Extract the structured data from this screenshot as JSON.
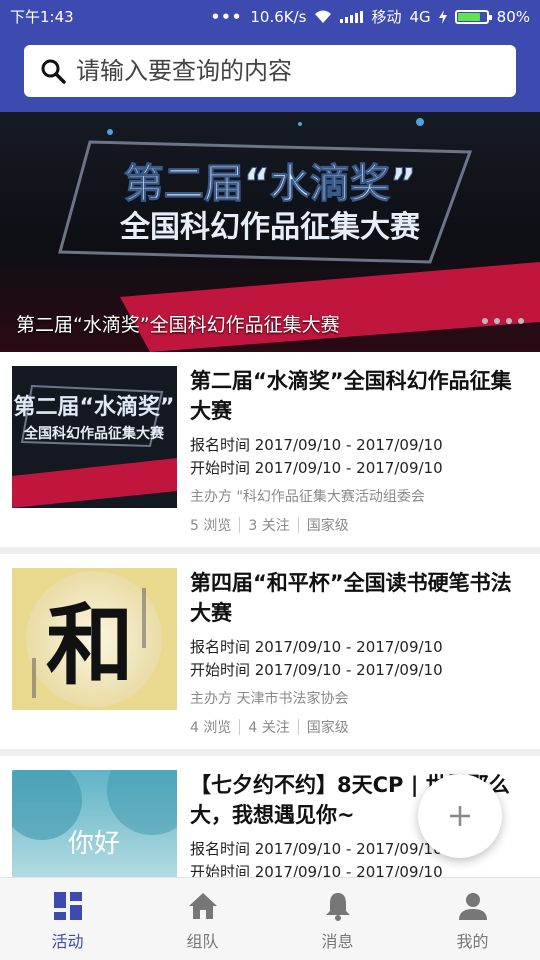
{
  "status_bar": {
    "time": "下午1:43",
    "net_speed": "10.6K/s",
    "carrier": "移动",
    "network": "4G",
    "battery": "80%",
    "battery_level": 0.8
  },
  "search": {
    "placeholder": "请输入要查询的内容"
  },
  "banner": {
    "caption": "第二届“水滴奖”全国科幻作品征集大赛",
    "art_line1": "第二届“水滴奖”",
    "art_line2": "全国科幻作品征集大赛"
  },
  "cards": [
    {
      "title": "第二届“水滴奖”全国科幻作品征集大赛",
      "signup": "报名时间 2017/09/10 - 2017/09/10",
      "start": "开始时间 2017/09/10 - 2017/09/10",
      "host": "主办方 \"科幻作品征集大赛活动组委会",
      "views": "5 浏览",
      "follows": "3 关注",
      "level": "国家级"
    },
    {
      "title": "第四届“和平杯”全国读书硬笔书法大赛",
      "signup": "报名时间 2017/09/10 - 2017/09/10",
      "start": "开始时间 2017/09/10 - 2017/09/10",
      "host": "主办方 天津市书法家协会",
      "views": "4 浏览",
      "follows": "4 关注",
      "level": "国家级",
      "thumb_char": "和"
    },
    {
      "title": "【七夕约不约】8天CP | 世界那么大，我想遇见你~",
      "signup": "报名时间 2017/09/10 - 2017/09/10",
      "start": "开始时间 2017/09/10 - 2017/09/10",
      "thumb_text": "你好"
    }
  ],
  "bottom_nav": [
    {
      "label": "活动",
      "icon": "dashboard-icon",
      "active": true
    },
    {
      "label": "组队",
      "icon": "home-icon",
      "active": false
    },
    {
      "label": "消息",
      "icon": "bell-icon",
      "active": false
    },
    {
      "label": "我的",
      "icon": "person-icon",
      "active": false
    }
  ],
  "colors": {
    "primary": "#3d4bb1",
    "inactive": "#777777"
  }
}
